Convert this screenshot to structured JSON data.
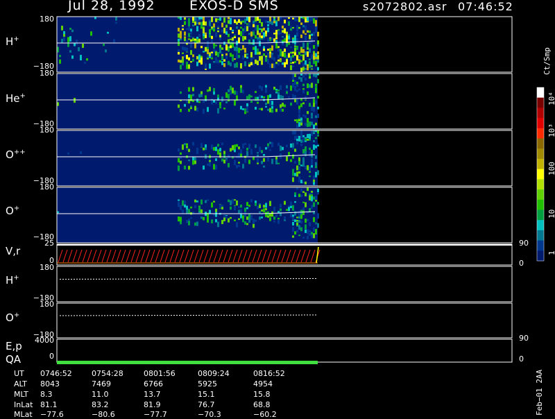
{
  "header": {
    "date": "Jul 28, 1992",
    "instrument": "EXOS-D SMS",
    "file": "s2072802.asr",
    "time": "07:46:52"
  },
  "panels": [
    {
      "label": "H",
      "sup": "+",
      "top_tick": "180",
      "bottom_tick": "−180"
    },
    {
      "label": "He",
      "sup": "+",
      "top_tick": "180",
      "bottom_tick": "−180"
    },
    {
      "label": "O",
      "sup": "++",
      "top_tick": "180",
      "bottom_tick": "−180"
    },
    {
      "label": "O",
      "sup": "+",
      "top_tick": "180",
      "bottom_tick": "−180"
    }
  ],
  "vr_panel": {
    "label": "V,r",
    "top_tick": "25",
    "bottom_tick": "0",
    "right_top": "90",
    "right_bottom": "0"
  },
  "line_panels": [
    {
      "label": "H",
      "sup": "+",
      "top_tick": "180",
      "bottom_tick": "−180"
    },
    {
      "label": "O",
      "sup": "+",
      "top_tick": "180",
      "bottom_tick": "−180"
    }
  ],
  "ep_panel": {
    "label": "E,p",
    "top_tick": "4000",
    "bottom_tick": "0",
    "right_top": "90",
    "right_bottom": "0"
  },
  "qa_panel": {
    "label": "QA"
  },
  "colorbar": {
    "unit": "Ct/Smp",
    "labels": [
      "10⁴",
      "10³",
      "100",
      "10",
      "1"
    ],
    "colors": [
      "#ffffff",
      "#7a0000",
      "#b00000",
      "#e00000",
      "#ff2a00",
      "#8a6a00",
      "#a08a00",
      "#c0b000",
      "#ffff00",
      "#b0e000",
      "#60d000",
      "#20c000",
      "#00a040",
      "#00c0c0",
      "#007890",
      "#003890",
      "#001a6e"
    ]
  },
  "ephemeris": {
    "rows": [
      {
        "name": "UT",
        "values": [
          "0746:52",
          "0754:28",
          "0801:56",
          "0809:24",
          "0816:52"
        ]
      },
      {
        "name": "ALT",
        "values": [
          "8043",
          "7469",
          "6766",
          "5925",
          "4954"
        ]
      },
      {
        "name": "MLT",
        "values": [
          "8.3",
          "11.0",
          "13.7",
          "15.1",
          "15.8"
        ]
      },
      {
        "name": "InLat",
        "values": [
          "81.1",
          "83.2",
          "81.9",
          "76.7",
          "68.8"
        ]
      },
      {
        "name": "MLat",
        "values": [
          "−77.6",
          "−80.6",
          "−77.7",
          "−70.3",
          "−60.2"
        ]
      }
    ]
  },
  "footer": "Feb−01 2AA",
  "chart_data": {
    "type": "heatmap",
    "title": "Jul 28, 1992   EXOS-D SMS",
    "x": {
      "ticks": [
        "0746:52",
        "0754:28",
        "0801:56",
        "0809:24",
        "0816:52"
      ]
    },
    "panels": [
      {
        "name": "H+",
        "ylim": [
          -180,
          180
        ],
        "active_to": "0816:52"
      },
      {
        "name": "He+",
        "ylim": [
          -180,
          180
        ],
        "active_to": "0816:52"
      },
      {
        "name": "O++",
        "ylim": [
          -180,
          180
        ],
        "active_to": "0816:52"
      },
      {
        "name": "O+",
        "ylim": [
          -180,
          180
        ],
        "active_to": "0816:52"
      }
    ],
    "colorscale": {
      "unit": "Ct/Smp",
      "range": [
        1,
        10000
      ],
      "log": true
    }
  }
}
